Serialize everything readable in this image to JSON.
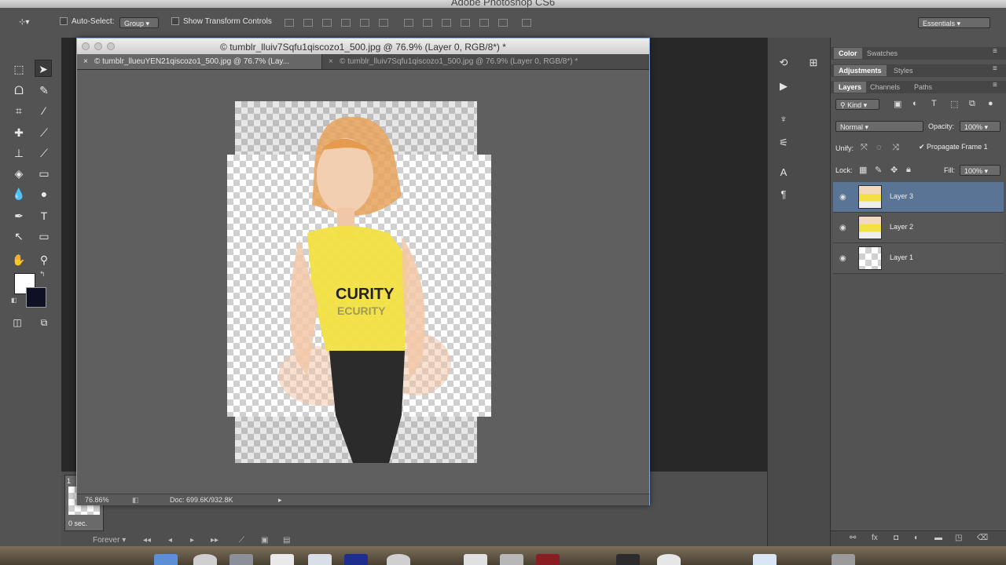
{
  "app_title": "Adobe Photoshop CS6",
  "options_bar": {
    "auto_select_label": "Auto-Select:",
    "auto_select_value": "Group",
    "show_transform_label": "Show Transform Controls",
    "workspace": "Essentials"
  },
  "document": {
    "window_title": "© tumblr_lluiv7Sqfu1qiscozo1_500.jpg @ 76.9% (Layer 0, RGB/8*) *",
    "tabs": [
      {
        "label": "© tumblr_llueuYEN21qiscozo1_500.jpg @ 76.7% (Lay...",
        "active": true
      },
      {
        "label": "© tumblr_lluiv7Sqfu1qiscozo1_500.jpg @ 76.9% (Layer 0, RGB/8*) *",
        "active": false
      }
    ],
    "zoom": "76.86%",
    "doc_size": "Doc: 699.6K/932.8K",
    "shirt_text_1": "CURITY",
    "shirt_text_2": "ECURITY"
  },
  "panels": {
    "group1_tabs": [
      "Color",
      "Swatches"
    ],
    "group2_tabs": [
      "Adjustments",
      "Styles"
    ],
    "group3_tabs": [
      "Layers",
      "Channels",
      "Paths"
    ],
    "kind_filter": "Kind",
    "blend_mode": "Normal",
    "opacity_label": "Opacity:",
    "opacity_value": "100%",
    "unify_label": "Unify:",
    "propagate_label": "Propagate Frame 1",
    "lock_label": "Lock:",
    "fill_label": "Fill:",
    "fill_value": "100%",
    "layers": [
      {
        "name": "Layer 3",
        "selected": true,
        "thumb": "photo"
      },
      {
        "name": "Layer 2",
        "selected": false,
        "thumb": "photo"
      },
      {
        "name": "Layer 1",
        "selected": false,
        "thumb": "transparent"
      }
    ]
  },
  "timeline": {
    "frame_number": "1",
    "frame_delay": "0 sec.",
    "loop": "Forever"
  },
  "colors": {
    "foreground": "#ffffff",
    "background": "#0f1024",
    "selection": "#5a7496"
  }
}
